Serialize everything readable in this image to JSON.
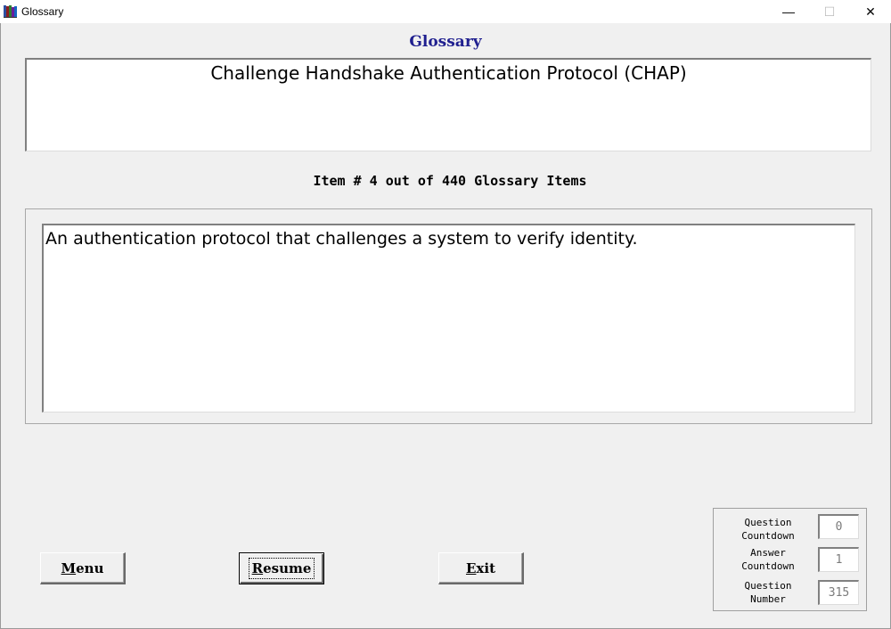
{
  "window": {
    "title": "Glossary",
    "controls": {
      "minimize": "—",
      "maximize": "☐",
      "close": "✕"
    }
  },
  "page": {
    "heading": "Glossary",
    "term": "Challenge Handshake Authentication Protocol (CHAP)",
    "item_count": "Item # 4 out of 440 Glossary Items",
    "definition": "An authentication protocol that challenges a system to verify identity."
  },
  "buttons": {
    "menu": {
      "accel": "M",
      "rest": "enu"
    },
    "resume": {
      "accel": "R",
      "rest": "esume"
    },
    "exit": {
      "accel": "E",
      "rest": "xit"
    }
  },
  "counters": {
    "question_countdown": {
      "line1": "Question",
      "line2": "Countdown",
      "value": "0"
    },
    "answer_countdown": {
      "line1": "Answer",
      "line2": "Countdown",
      "value": "1"
    },
    "question_number": {
      "line1": "Question",
      "line2": "Number",
      "value": "315"
    }
  },
  "colors": {
    "heading": "#1f1f8f",
    "background": "#f0f0f0"
  },
  "icons": {
    "app": "books-icon"
  }
}
